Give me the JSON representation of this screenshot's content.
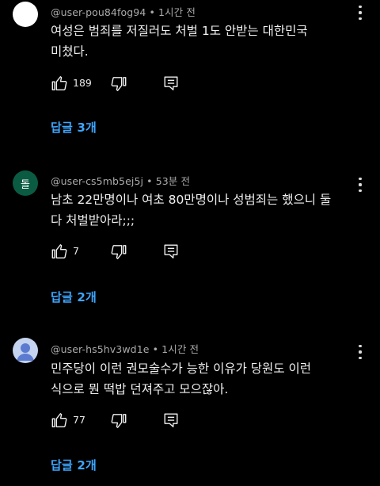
{
  "comments": [
    {
      "avatar_initial": "",
      "avatar_color": "#ffffff",
      "username": "@user-pou84fog94",
      "time": "1시간 전",
      "lines": [
        "여성은 범죄를 저질러도 처벌 1도 안받는 대한민국",
        "미쳤다."
      ],
      "likes": "189",
      "replies_label": "답글 3개"
    },
    {
      "avatar_initial": "돌",
      "avatar_color": "#0b5b43",
      "username": "@user-cs5mb5ej5j",
      "time": "53분 전",
      "lines": [
        "남초 22만명이나 여초 80만명이나 성범죄는 했으니 둘",
        "다 처벌받아라;;;"
      ],
      "likes": "7",
      "replies_label": "답글 2개"
    },
    {
      "avatar_initial": "",
      "avatar_color": "#c4d3ee",
      "username": "@user-hs5hv3wd1e",
      "time": "1시간 전",
      "lines": [
        "민주당이 이런 권모술수가 능한 이유가  당원도 이런",
        "식으로 뭔 떡밥 던져주고 모으잖아."
      ],
      "likes": "77",
      "replies_label": "답글 2개"
    }
  ],
  "meta_separator": " • ",
  "icons": [
    "like-icon",
    "dislike-icon",
    "reply-icon",
    "more-options-icon"
  ],
  "colors": {
    "background": "#000000",
    "text": "#f1f1f1",
    "meta": "#aaaaaa",
    "link": "#3ea6ff"
  }
}
